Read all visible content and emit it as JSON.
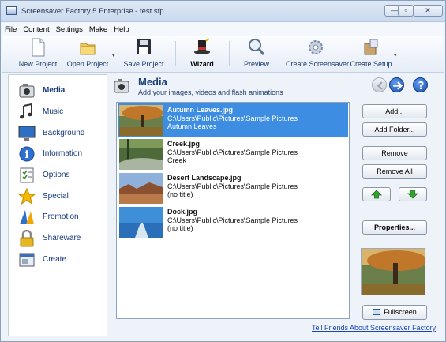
{
  "window": {
    "title": "Screensaver Factory 5 Enterprise - test.sfp",
    "buttons": {
      "minimize": "—",
      "maximize": "▫",
      "close": "✕"
    }
  },
  "menu": [
    "File",
    "Content",
    "Settings",
    "Make",
    "Help"
  ],
  "toolbar": {
    "new_project": "New Project",
    "open_project": "Open Project",
    "save_project": "Save Project",
    "wizard": "Wizard",
    "preview": "Preview",
    "create_screensaver": "Create Screensaver",
    "create_setup": "Create Setup",
    "dropdown_arrow": "▾"
  },
  "sidebar": [
    {
      "label": "Media",
      "icon": "camera-icon"
    },
    {
      "label": "Music",
      "icon": "music-notes-icon"
    },
    {
      "label": "Background",
      "icon": "monitor-icon"
    },
    {
      "label": "Information",
      "icon": "info-icon"
    },
    {
      "label": "Options",
      "icon": "options-checklist-icon"
    },
    {
      "label": "Special",
      "icon": "star-icon"
    },
    {
      "label": "Promotion",
      "icon": "promotion-icon"
    },
    {
      "label": "Shareware",
      "icon": "padlock-icon"
    },
    {
      "label": "Create",
      "icon": "create-window-icon"
    }
  ],
  "header": {
    "title": "Media",
    "subtitle": "Add your images, videos and flash animations"
  },
  "media_items": [
    {
      "name": "Autumn Leaves.jpg",
      "path": "C:\\Users\\Public\\Pictures\\Sample Pictures",
      "title": "Autumn Leaves",
      "selected": true
    },
    {
      "name": "Creek.jpg",
      "path": "C:\\Users\\Public\\Pictures\\Sample Pictures",
      "title": "Creek",
      "selected": false
    },
    {
      "name": "Desert Landscape.jpg",
      "path": "C:\\Users\\Public\\Pictures\\Sample Pictures",
      "title": "(no title)",
      "selected": false
    },
    {
      "name": "Dock.jpg",
      "path": "C:\\Users\\Public\\Pictures\\Sample Pictures",
      "title": "(no title)",
      "selected": false
    }
  ],
  "buttons": {
    "add": "Add...",
    "add_folder": "Add Folder...",
    "remove": "Remove",
    "remove_all": "Remove All",
    "properties": "Properties...",
    "fullscreen": "Fullscreen"
  },
  "footer_link": "Tell Friends About Screensaver Factory",
  "colors": {
    "selection": "#3d8ee3",
    "link": "#1b45b5",
    "heading": "#1a3f7a",
    "sidebar_text": "#14367a",
    "arrow_green": "#2ea52e"
  }
}
